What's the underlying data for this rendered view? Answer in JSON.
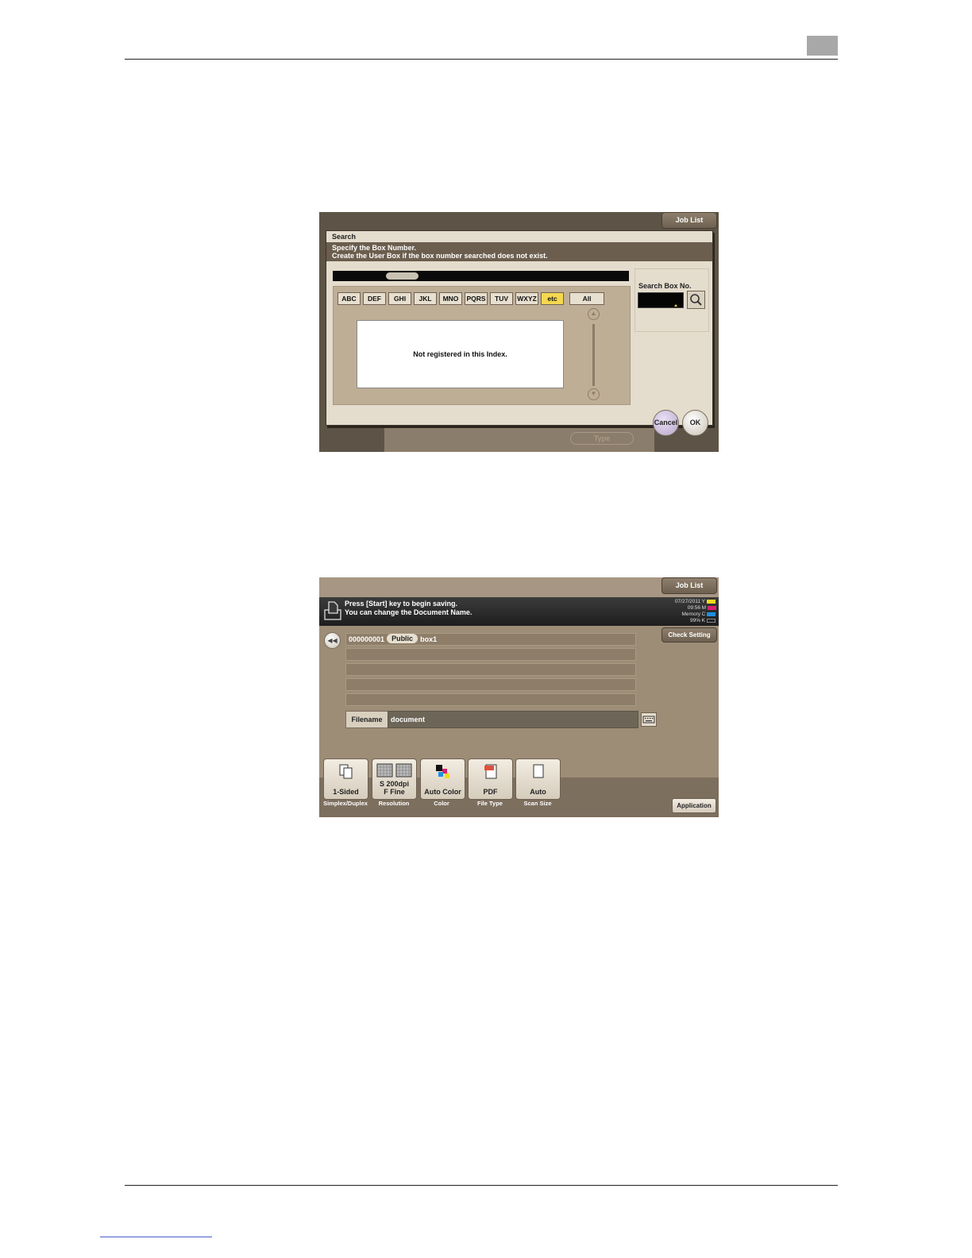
{
  "screen1": {
    "job_list": "Job List",
    "dialog_title": "Search",
    "message_line1": "Specify the Box Number.",
    "message_line2": "Create the User Box if the box number searched does not exist.",
    "tabs": [
      "ABC",
      "DEF",
      "GHI",
      "JKL",
      "MNO",
      "PQRS",
      "TUV",
      "WXYZ",
      "etc",
      "All"
    ],
    "active_tab": "etc",
    "empty_message": "Not registered in this Index.",
    "search_label": "Search Box No.",
    "search_value": "",
    "cancel": "Cancel",
    "ok": "OK",
    "background_button": "Type"
  },
  "screen2": {
    "job_list": "Job List",
    "message_line1": "Press [Start] key to begin saving.",
    "message_line2": "You can change the Document Name.",
    "status_date": "07/27/2011",
    "status_time": "09:56",
    "status_memory_label": "Memory",
    "status_memory_value": "99%",
    "toner": [
      "Y",
      "M",
      "C",
      "K"
    ],
    "toner_colors": [
      "#f3d820",
      "#d8206e",
      "#1f8fe0",
      "#222222"
    ],
    "check_setting": "Check Setting",
    "box_number": "000000001",
    "box_type": "Public",
    "box_name": "box1",
    "filename_label": "Filename",
    "filename_value": "document",
    "functions": [
      {
        "label": "1-Sided",
        "caption": "Simplex/Duplex"
      },
      {
        "label": "S 200dpi F Fine",
        "caption": "Resolution"
      },
      {
        "label": "Auto Color",
        "caption": "Color"
      },
      {
        "label": "PDF",
        "caption": "File Type"
      },
      {
        "label": "Auto",
        "caption": "Scan Size"
      }
    ],
    "application": "Application"
  }
}
